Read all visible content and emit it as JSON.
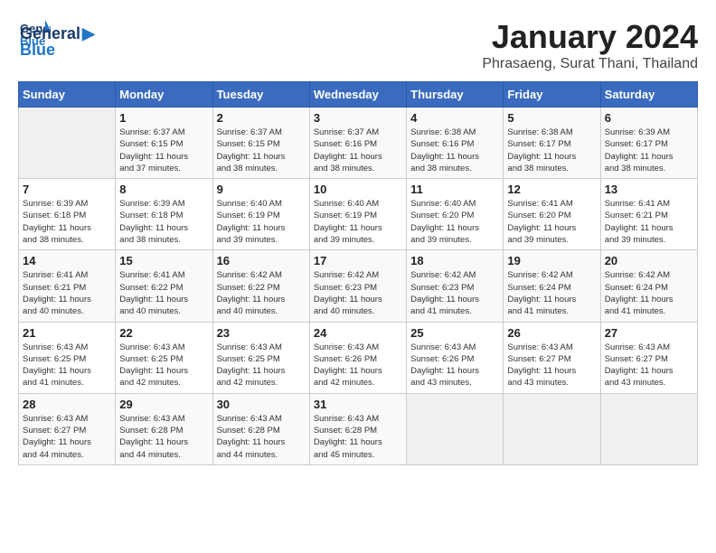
{
  "logo": {
    "line1": "General",
    "line2": "Blue"
  },
  "title": "January 2024",
  "location": "Phrasaeng, Surat Thani, Thailand",
  "days_of_week": [
    "Sunday",
    "Monday",
    "Tuesday",
    "Wednesday",
    "Thursday",
    "Friday",
    "Saturday"
  ],
  "weeks": [
    [
      {
        "day": "",
        "info": ""
      },
      {
        "day": "1",
        "info": "Sunrise: 6:37 AM\nSunset: 6:15 PM\nDaylight: 11 hours\nand 37 minutes."
      },
      {
        "day": "2",
        "info": "Sunrise: 6:37 AM\nSunset: 6:15 PM\nDaylight: 11 hours\nand 38 minutes."
      },
      {
        "day": "3",
        "info": "Sunrise: 6:37 AM\nSunset: 6:16 PM\nDaylight: 11 hours\nand 38 minutes."
      },
      {
        "day": "4",
        "info": "Sunrise: 6:38 AM\nSunset: 6:16 PM\nDaylight: 11 hours\nand 38 minutes."
      },
      {
        "day": "5",
        "info": "Sunrise: 6:38 AM\nSunset: 6:17 PM\nDaylight: 11 hours\nand 38 minutes."
      },
      {
        "day": "6",
        "info": "Sunrise: 6:39 AM\nSunset: 6:17 PM\nDaylight: 11 hours\nand 38 minutes."
      }
    ],
    [
      {
        "day": "7",
        "info": "Sunrise: 6:39 AM\nSunset: 6:18 PM\nDaylight: 11 hours\nand 38 minutes."
      },
      {
        "day": "8",
        "info": "Sunrise: 6:39 AM\nSunset: 6:18 PM\nDaylight: 11 hours\nand 38 minutes."
      },
      {
        "day": "9",
        "info": "Sunrise: 6:40 AM\nSunset: 6:19 PM\nDaylight: 11 hours\nand 39 minutes."
      },
      {
        "day": "10",
        "info": "Sunrise: 6:40 AM\nSunset: 6:19 PM\nDaylight: 11 hours\nand 39 minutes."
      },
      {
        "day": "11",
        "info": "Sunrise: 6:40 AM\nSunset: 6:20 PM\nDaylight: 11 hours\nand 39 minutes."
      },
      {
        "day": "12",
        "info": "Sunrise: 6:41 AM\nSunset: 6:20 PM\nDaylight: 11 hours\nand 39 minutes."
      },
      {
        "day": "13",
        "info": "Sunrise: 6:41 AM\nSunset: 6:21 PM\nDaylight: 11 hours\nand 39 minutes."
      }
    ],
    [
      {
        "day": "14",
        "info": "Sunrise: 6:41 AM\nSunset: 6:21 PM\nDaylight: 11 hours\nand 40 minutes."
      },
      {
        "day": "15",
        "info": "Sunrise: 6:41 AM\nSunset: 6:22 PM\nDaylight: 11 hours\nand 40 minutes."
      },
      {
        "day": "16",
        "info": "Sunrise: 6:42 AM\nSunset: 6:22 PM\nDaylight: 11 hours\nand 40 minutes."
      },
      {
        "day": "17",
        "info": "Sunrise: 6:42 AM\nSunset: 6:23 PM\nDaylight: 11 hours\nand 40 minutes."
      },
      {
        "day": "18",
        "info": "Sunrise: 6:42 AM\nSunset: 6:23 PM\nDaylight: 11 hours\nand 41 minutes."
      },
      {
        "day": "19",
        "info": "Sunrise: 6:42 AM\nSunset: 6:24 PM\nDaylight: 11 hours\nand 41 minutes."
      },
      {
        "day": "20",
        "info": "Sunrise: 6:42 AM\nSunset: 6:24 PM\nDaylight: 11 hours\nand 41 minutes."
      }
    ],
    [
      {
        "day": "21",
        "info": "Sunrise: 6:43 AM\nSunset: 6:25 PM\nDaylight: 11 hours\nand 41 minutes."
      },
      {
        "day": "22",
        "info": "Sunrise: 6:43 AM\nSunset: 6:25 PM\nDaylight: 11 hours\nand 42 minutes."
      },
      {
        "day": "23",
        "info": "Sunrise: 6:43 AM\nSunset: 6:25 PM\nDaylight: 11 hours\nand 42 minutes."
      },
      {
        "day": "24",
        "info": "Sunrise: 6:43 AM\nSunset: 6:26 PM\nDaylight: 11 hours\nand 42 minutes."
      },
      {
        "day": "25",
        "info": "Sunrise: 6:43 AM\nSunset: 6:26 PM\nDaylight: 11 hours\nand 43 minutes."
      },
      {
        "day": "26",
        "info": "Sunrise: 6:43 AM\nSunset: 6:27 PM\nDaylight: 11 hours\nand 43 minutes."
      },
      {
        "day": "27",
        "info": "Sunrise: 6:43 AM\nSunset: 6:27 PM\nDaylight: 11 hours\nand 43 minutes."
      }
    ],
    [
      {
        "day": "28",
        "info": "Sunrise: 6:43 AM\nSunset: 6:27 PM\nDaylight: 11 hours\nand 44 minutes."
      },
      {
        "day": "29",
        "info": "Sunrise: 6:43 AM\nSunset: 6:28 PM\nDaylight: 11 hours\nand 44 minutes."
      },
      {
        "day": "30",
        "info": "Sunrise: 6:43 AM\nSunset: 6:28 PM\nDaylight: 11 hours\nand 44 minutes."
      },
      {
        "day": "31",
        "info": "Sunrise: 6:43 AM\nSunset: 6:28 PM\nDaylight: 11 hours\nand 45 minutes."
      },
      {
        "day": "",
        "info": ""
      },
      {
        "day": "",
        "info": ""
      },
      {
        "day": "",
        "info": ""
      }
    ]
  ]
}
